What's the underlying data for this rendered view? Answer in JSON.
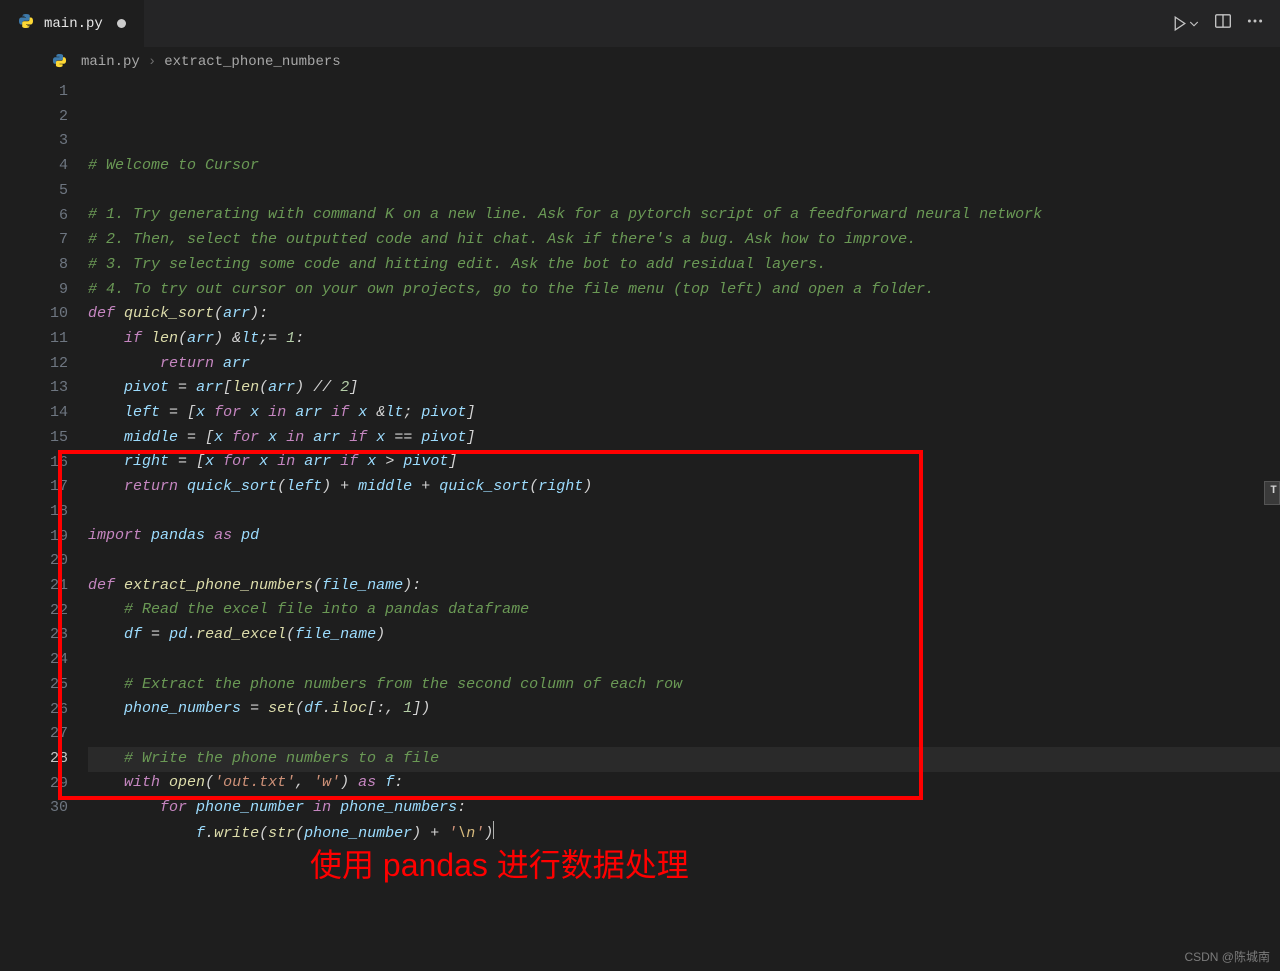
{
  "tab": {
    "filename": "main.py"
  },
  "breadcrumb": {
    "file": "main.py",
    "symbol": "extract_phone_numbers"
  },
  "annotation": "使用 pandas 进行数据处理",
  "watermark": "CSDN @陈城南",
  "current_line": 28,
  "lines": [
    "# Welcome to Cursor",
    "",
    "# 1. Try generating with command K on a new line. Ask for a pytorch script of a feedforward neural network",
    "# 2. Then, select the outputted code and hit chat. Ask if there's a bug. Ask how to improve.",
    "# 3. Try selecting some code and hitting edit. Ask the bot to add residual layers.",
    "# 4. To try out cursor on your own projects, go to the file menu (top left) and open a folder.",
    "def quick_sort(arr):",
    "    if len(arr) <= 1:",
    "        return arr",
    "    pivot = arr[len(arr) // 2]",
    "    left = [x for x in arr if x < pivot]",
    "    middle = [x for x in arr if x == pivot]",
    "    right = [x for x in arr if x > pivot]",
    "    return quick_sort(left) + middle + quick_sort(right)",
    "",
    "import pandas as pd",
    "",
    "def extract_phone_numbers(file_name):",
    "    # Read the excel file into a pandas dataframe",
    "    df = pd.read_excel(file_name)",
    "",
    "    # Extract the phone numbers from the second column of each row",
    "    phone_numbers = set(df.iloc[:, 1])",
    "",
    "    # Write the phone numbers to a file",
    "    with open('out.txt', 'w') as f:",
    "        for phone_number in phone_numbers:",
    "            f.write(str(phone_number) + '\\n')",
    "",
    ""
  ]
}
